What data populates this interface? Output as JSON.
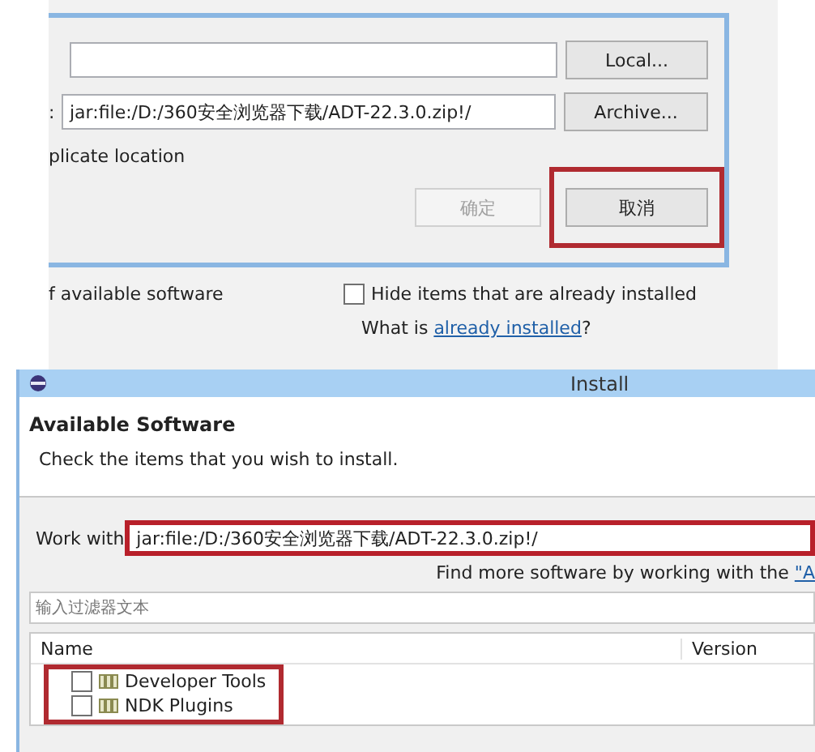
{
  "location_dialog": {
    "location_label": ":",
    "local_button": "Local...",
    "location_value": "jar:file:/D:/360安全浏览器下载/ADT-22.3.0.zip!/",
    "archive_button": "Archive...",
    "duplicate_label": "plicate location",
    "ok_button": {
      "label": "确定",
      "disabled": true
    },
    "cancel_button": {
      "label": "取消",
      "highlighted": true
    }
  },
  "background_window": {
    "available_label": "f available software",
    "hide_installed": {
      "label": "Hide items that are already installed",
      "checked": false
    },
    "what_is": {
      "before": "What is ",
      "link": "already installed",
      "after": "?"
    }
  },
  "install_window": {
    "title": "Install",
    "heading": "Available Software",
    "subtitle": "Check the items that you wish to install.",
    "work_with_label": "Work with",
    "work_with_value": "jar:file:/D:/360安全浏览器下载/ADT-22.3.0.zip!/",
    "work_with_highlighted": true,
    "find_more": {
      "text": "Find more software by working with the ",
      "link": "\"A"
    },
    "filter_placeholder": "输入过滤器文本",
    "columns": [
      "Name",
      "Version"
    ],
    "items": [
      {
        "label": "Developer Tools",
        "checked": false
      },
      {
        "label": "NDK Plugins",
        "checked": false
      }
    ],
    "items_highlighted": true
  }
}
